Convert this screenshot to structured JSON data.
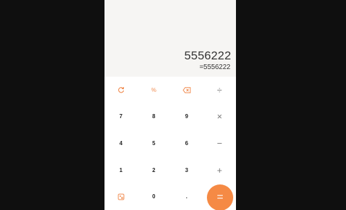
{
  "display": {
    "expression": "5556222",
    "result": "=5556222"
  },
  "keys": {
    "clear_icon": "refresh-clear-icon",
    "percent": "%",
    "backspace_icon": "backspace-icon",
    "divide": "÷",
    "seven": "7",
    "eight": "8",
    "nine": "9",
    "multiply": "×",
    "four": "4",
    "five": "5",
    "six": "6",
    "minus": "−",
    "one": "1",
    "two": "2",
    "three": "3",
    "plus": "+",
    "mode_icon": "function-toggle-icon",
    "zero": "0",
    "dot": ".",
    "equals": "="
  },
  "colors": {
    "accent": "#f58a45",
    "background": "#0f0f0f",
    "display_bg": "#f6f5f3"
  }
}
